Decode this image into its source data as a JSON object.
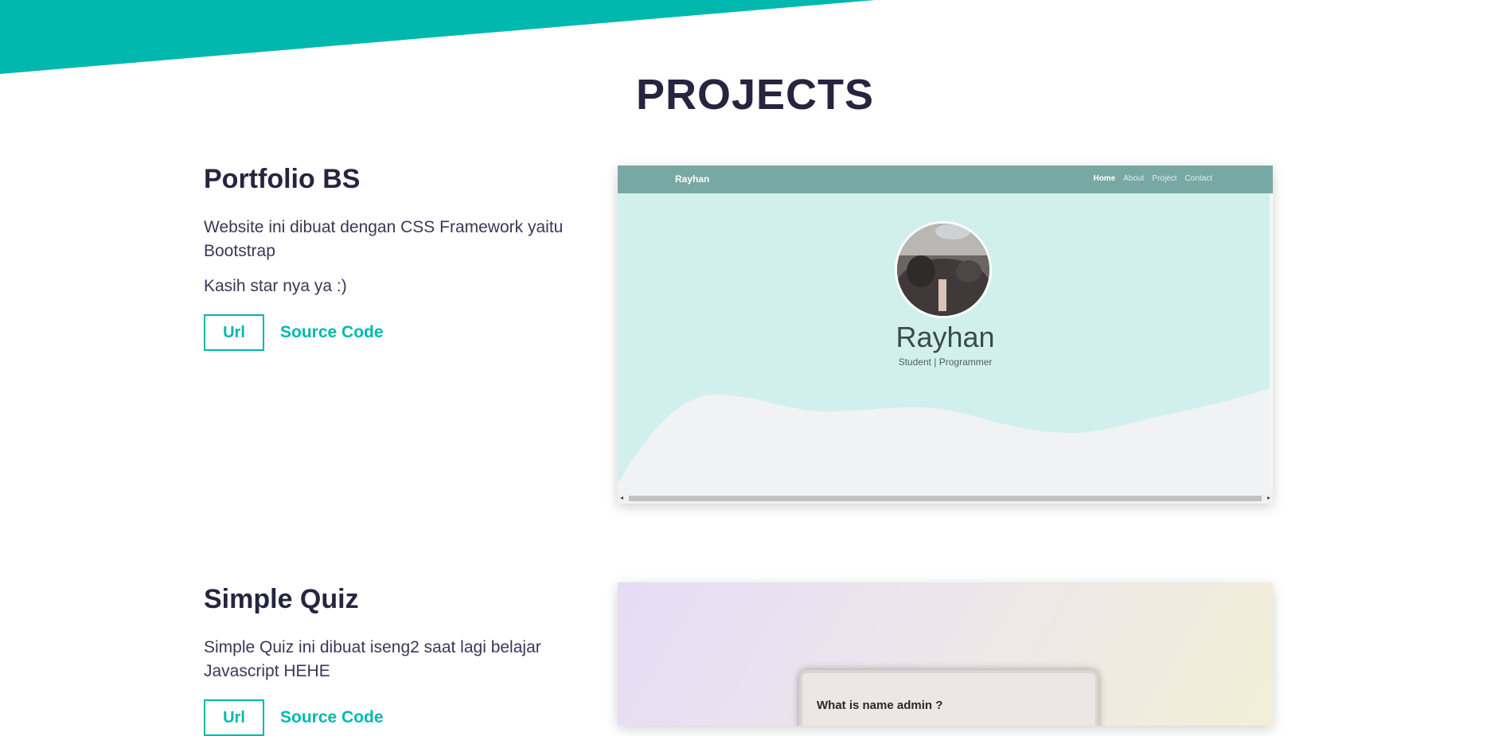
{
  "section": {
    "title": "PROJECTS"
  },
  "colors": {
    "accent": "#00b8ad",
    "heading": "#27243f",
    "text": "#3a3756"
  },
  "projects": [
    {
      "title": "Portfolio BS",
      "description": "Website ini dibuat dengan CSS Framework yaitu Bootstrap",
      "note": "Kasih star nya ya :)",
      "url_label": "Url",
      "source_label": "Source Code",
      "preview": {
        "brand": "Rayhan",
        "nav": [
          "Home",
          "About",
          "Project",
          "Contact"
        ],
        "name": "Rayhan",
        "role": "Student | Programmer"
      }
    },
    {
      "title": "Simple Quiz",
      "description": "Simple Quiz ini dibuat iseng2 saat lagi belajar Javascript HEHE",
      "url_label": "Url",
      "source_label": "Source Code",
      "preview": {
        "question": "What is name admin ?"
      }
    }
  ]
}
